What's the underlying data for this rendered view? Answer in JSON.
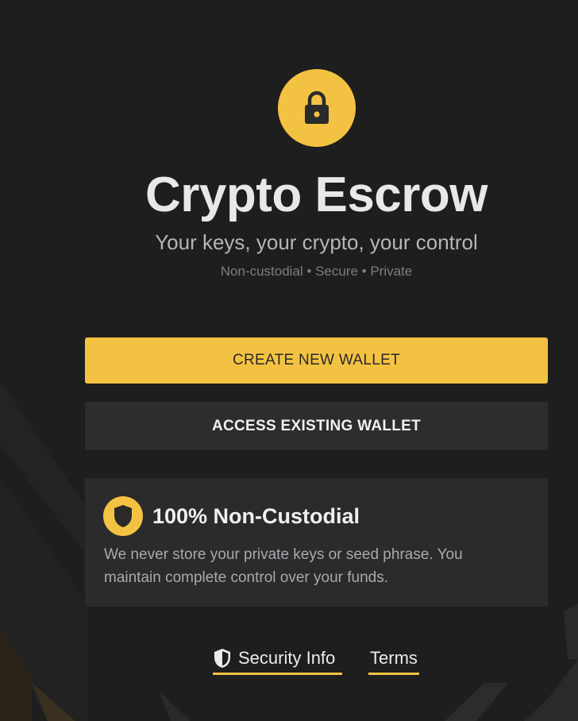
{
  "header": {
    "title": "Crypto Escrow",
    "subtitle": "Your keys, your crypto, your control",
    "tagline": "Non-custodial • Secure • Private"
  },
  "actions": {
    "create_label": "CREATE NEW WALLET",
    "access_label": "ACCESS EXISTING WALLET"
  },
  "info_card": {
    "title": "100% Non-Custodial",
    "text": "We never store your private keys or seed phrase. You maintain complete control over your funds."
  },
  "footer": {
    "security_label": "Security Info",
    "terms_label": "Terms"
  },
  "icons": {
    "logo": "lock-icon",
    "card": "shield-icon",
    "security": "shield-check-icon"
  },
  "colors": {
    "accent": "#f4c242",
    "background": "#1e1e1e",
    "card": "#2b2b2c",
    "secondary_button": "#2d2d2e"
  }
}
